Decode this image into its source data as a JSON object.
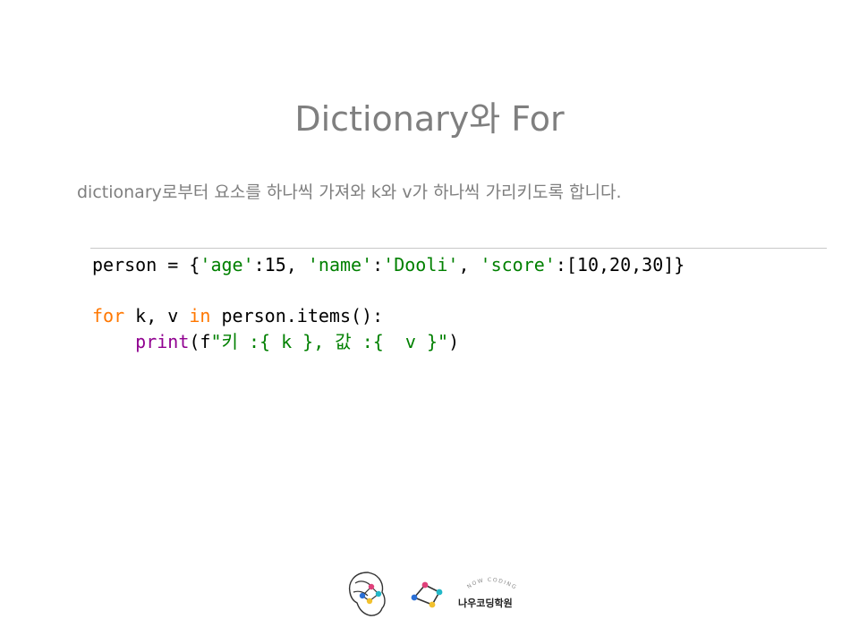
{
  "slide": {
    "title": "Dictionary와 For",
    "subtitle": "dictionary로부터 요소를 하나씩 가져와 k와 v가 하나씩 가리키도록 합니다."
  },
  "code": {
    "line1": {
      "t1": "person = {",
      "t2": "'age'",
      "t3": ":15, ",
      "t4": "'name'",
      "t5": ":",
      "t6": "'Dooli'",
      "t7": ", ",
      "t8": "'score'",
      "t9": ":[10,20,30]}"
    },
    "line3": {
      "t1": "for",
      "t2": " k, v ",
      "t3": "in",
      "t4": " person.items():"
    },
    "line4": {
      "t1": "    ",
      "t2": "print",
      "t3": "(f",
      "t4": "\"키 :{ k }, 값 :{  v }\"",
      "t5": ")"
    }
  },
  "footer": {
    "brand_arc_text": "NOW CODING",
    "brand_name": "나우코딩학원"
  },
  "colors": {
    "title_gray": "#7f7f7f",
    "string_green": "#008000",
    "keyword_orange": "#ff7700",
    "builtin_purple": "#900090"
  }
}
